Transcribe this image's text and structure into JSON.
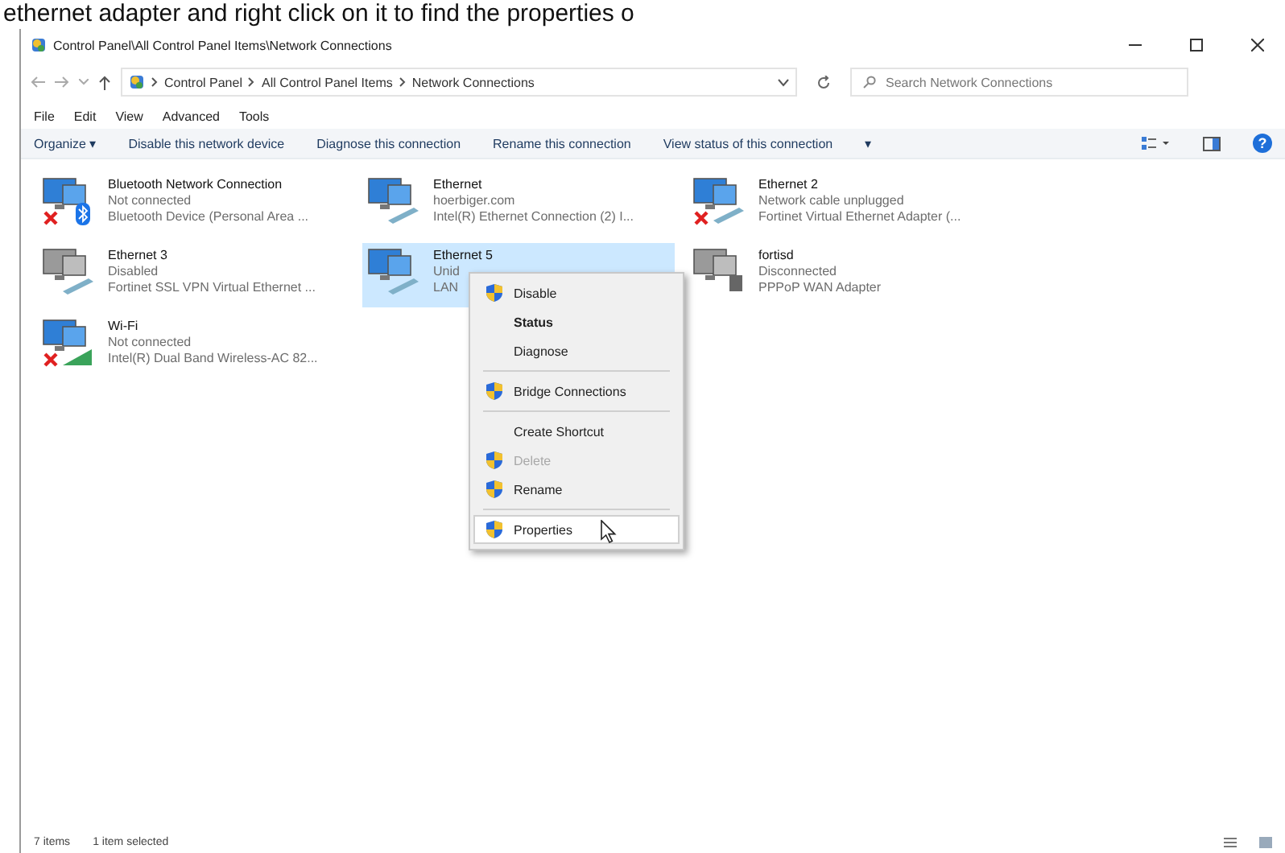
{
  "caption": "ethernet adapter and right click on it to find the properties o",
  "window": {
    "title": "Control Panel\\All Control Panel Items\\Network Connections"
  },
  "address": {
    "crumbs": [
      "Control Panel",
      "All Control Panel Items",
      "Network Connections"
    ],
    "search_placeholder": "Search Network Connections"
  },
  "menu_bar": [
    "File",
    "Edit",
    "View",
    "Advanced",
    "Tools"
  ],
  "command_bar": {
    "organize": "Organize ▾",
    "commands": [
      "Disable this network device",
      "Diagnose this connection",
      "Rename this connection",
      "View status of this connection"
    ],
    "more": "▾",
    "help": "?"
  },
  "connections": [
    {
      "name": "Bluetooth Network Connection",
      "status": "Not connected",
      "device": "Bluetooth Device (Personal Area ...",
      "kind": "bluetooth",
      "connected": false,
      "selected": false
    },
    {
      "name": "Ethernet",
      "status": "hoerbiger.com",
      "device": "Intel(R) Ethernet Connection (2) I...",
      "kind": "ethernet",
      "connected": true,
      "selected": false
    },
    {
      "name": "Ethernet 2",
      "status": "Network cable unplugged",
      "device": "Fortinet Virtual Ethernet Adapter (...",
      "kind": "ethernet",
      "connected": false,
      "selected": false
    },
    {
      "name": "Ethernet 3",
      "status": "Disabled",
      "device": "Fortinet SSL VPN Virtual Ethernet ...",
      "kind": "disabled",
      "connected": true,
      "selected": false
    },
    {
      "name": "Ethernet 5",
      "status": "Unid",
      "device": "LAN",
      "kind": "ethernet",
      "connected": true,
      "selected": true
    },
    {
      "name": "fortisd",
      "status": "Disconnected",
      "device": "PPPoP WAN Adapter",
      "kind": "dialup",
      "connected": true,
      "selected": false
    },
    {
      "name": "Wi-Fi",
      "status": "Not connected",
      "device": "Intel(R) Dual Band Wireless-AC 82...",
      "kind": "wifi",
      "connected": false,
      "selected": false
    }
  ],
  "context_menu": [
    [
      {
        "label": "Disable",
        "shield": true,
        "default": false,
        "disabled": false,
        "selected": false
      },
      {
        "label": "Status",
        "shield": false,
        "default": true,
        "disabled": false,
        "selected": false
      },
      {
        "label": "Diagnose",
        "shield": false,
        "default": false,
        "disabled": false,
        "selected": false
      }
    ],
    [
      {
        "label": "Bridge Connections",
        "shield": true,
        "default": false,
        "disabled": false,
        "selected": false
      }
    ],
    [
      {
        "label": "Create Shortcut",
        "shield": false,
        "default": false,
        "disabled": false,
        "selected": false
      },
      {
        "label": "Delete",
        "shield": true,
        "default": false,
        "disabled": true,
        "selected": false
      },
      {
        "label": "Rename",
        "shield": true,
        "default": false,
        "disabled": false,
        "selected": false
      }
    ],
    [
      {
        "label": "Properties",
        "shield": true,
        "default": false,
        "disabled": false,
        "selected": true
      }
    ]
  ],
  "status_bar": {
    "count": "7 items",
    "selection": "1 item selected"
  }
}
